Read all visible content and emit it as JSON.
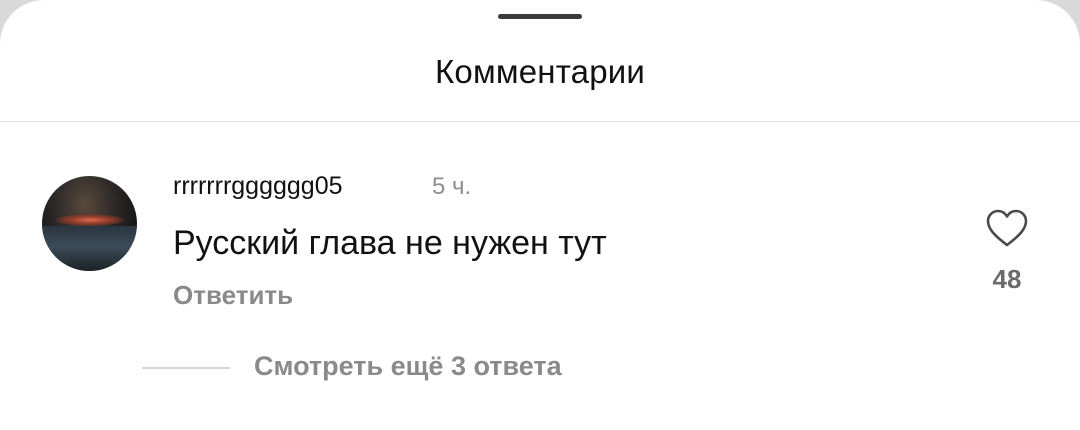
{
  "header": {
    "title": "Комментарии"
  },
  "comment": {
    "username": "rrrrrrrgggggg05",
    "timestamp": "5 ч.",
    "text": "Русский глава не нужен тут",
    "reply_label": "Ответить",
    "like_icon": "heart-outline-icon",
    "like_count": "48"
  },
  "replies": {
    "view_label": "Смотреть ещё 3 ответа"
  },
  "colors": {
    "text_primary": "#111111",
    "text_secondary": "#8a8a8a",
    "background": "#ffffff"
  }
}
